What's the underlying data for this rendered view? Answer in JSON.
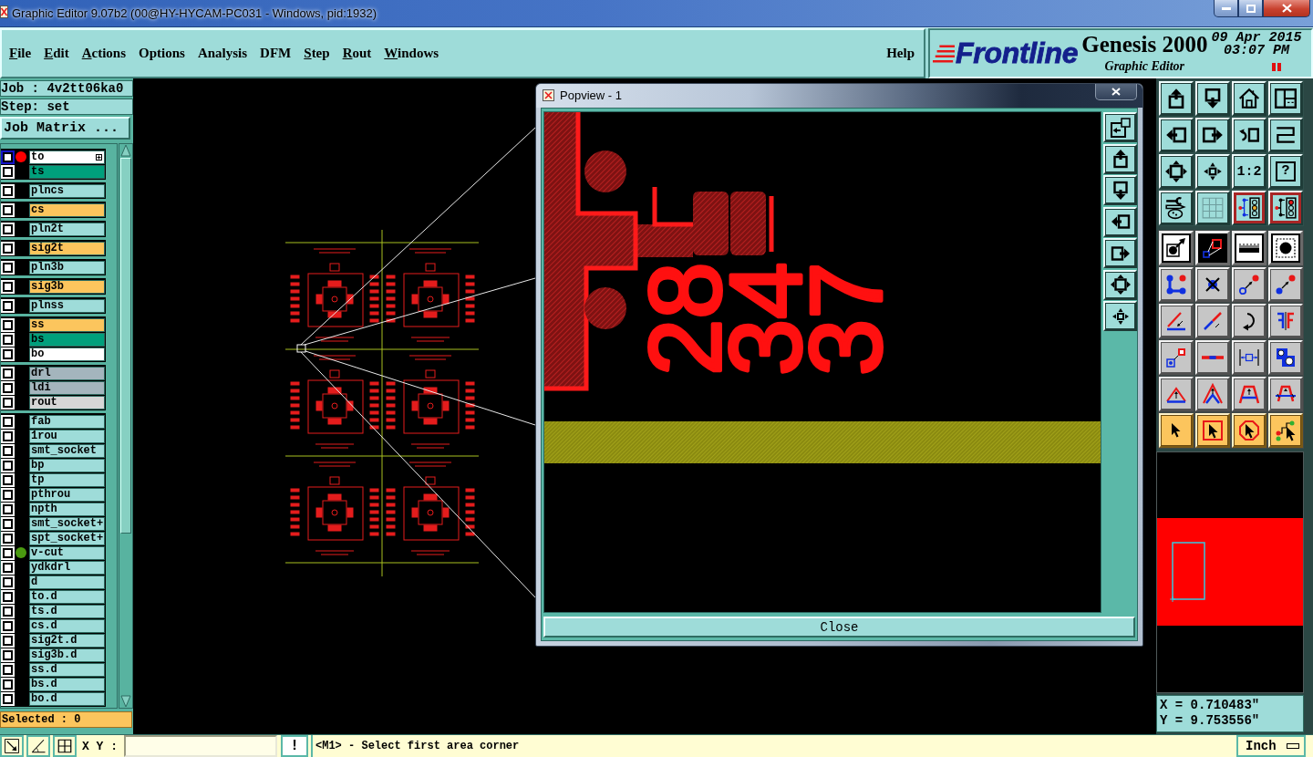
{
  "window": {
    "title": "Graphic Editor 9.07b2 (00@HY-HYCAM-PC031 - Windows, pid:1932)"
  },
  "menu": {
    "items": [
      {
        "label": "File",
        "underlined": true
      },
      {
        "label": "Edit",
        "underlined": true
      },
      {
        "label": "Actions",
        "underlined": true
      },
      {
        "label": "Options",
        "underlined": false
      },
      {
        "label": "Analysis",
        "underlined": false
      },
      {
        "label": "DFM",
        "underlined": false
      },
      {
        "label": "Step",
        "underlined": true
      },
      {
        "label": "Rout",
        "underlined": true
      },
      {
        "label": "Windows",
        "underlined": true
      }
    ],
    "help": {
      "label": "Help",
      "underlined": false
    }
  },
  "brand": {
    "logo": "Frontline",
    "product": "Genesis 2000",
    "subtitle": "Graphic Editor",
    "date": "09 Apr 2015",
    "time": "03:07 PM"
  },
  "job_panel": {
    "job": "Job : 4v2tt06ka0",
    "step": "Step: set",
    "matrix_button": "Job Matrix ...",
    "selected_count": "Selected : 0"
  },
  "layer_list": {
    "groups": [
      [
        {
          "name": "to",
          "color": "#ffffff",
          "checked": false,
          "selected": true,
          "dot": {
            "color": "#ff0000"
          }
        },
        {
          "name": "ts",
          "color": "#00a07c",
          "checked": false,
          "selected": false
        }
      ],
      [
        {
          "name": "plncs",
          "color": "#9edcd9",
          "checked": false,
          "selected": false
        }
      ],
      [
        {
          "name": "cs",
          "color": "#fcc55d",
          "checked": false,
          "selected": false
        }
      ],
      [
        {
          "name": "pln2t",
          "color": "#9edcd9",
          "checked": false,
          "selected": false
        }
      ],
      [
        {
          "name": "sig2t",
          "color": "#fcc55d",
          "checked": false,
          "selected": false
        }
      ],
      [
        {
          "name": "pln3b",
          "color": "#9edcd9",
          "checked": false,
          "selected": false
        }
      ],
      [
        {
          "name": "sig3b",
          "color": "#fcc55d",
          "checked": false,
          "selected": false
        }
      ],
      [
        {
          "name": "plnss",
          "color": "#9edcd9",
          "checked": false,
          "selected": false
        }
      ],
      [
        {
          "name": "ss",
          "color": "#fcc55d",
          "checked": false,
          "selected": false
        },
        {
          "name": "bs",
          "color": "#00a07c",
          "checked": false,
          "selected": false
        },
        {
          "name": "bo",
          "color": "#ffffff",
          "checked": false,
          "selected": false
        }
      ],
      [
        {
          "name": "drl",
          "color": "#a4b5bd",
          "checked": false,
          "selected": false
        },
        {
          "name": "ldi",
          "color": "#a4b5bd",
          "checked": false,
          "selected": false
        },
        {
          "name": "rout",
          "color": "#d6d6d6",
          "checked": false,
          "selected": false
        }
      ],
      [
        {
          "name": "fab",
          "color": "#9edcd9",
          "checked": false,
          "selected": false
        },
        {
          "name": "1rou",
          "color": "#9edcd9",
          "checked": false,
          "selected": false
        },
        {
          "name": "smt_socket",
          "color": "#9edcd9",
          "checked": false,
          "selected": false
        },
        {
          "name": "bp",
          "color": "#9edcd9",
          "checked": false,
          "selected": false
        },
        {
          "name": "tp",
          "color": "#9edcd9",
          "checked": false,
          "selected": false
        },
        {
          "name": "pthrou",
          "color": "#9edcd9",
          "checked": false,
          "selected": false
        },
        {
          "name": "npth",
          "color": "#9edcd9",
          "checked": false,
          "selected": false
        },
        {
          "name": "smt_socket+",
          "color": "#9edcd9",
          "checked": false,
          "selected": false
        },
        {
          "name": "spt_socket+",
          "color": "#9edcd9",
          "checked": false,
          "selected": false
        },
        {
          "name": "v-cut",
          "color": "#9edcd9",
          "checked": false,
          "selected": false,
          "dot": {
            "color": "#4a9a10"
          }
        },
        {
          "name": "ydkdrl",
          "color": "#9edcd9",
          "checked": false,
          "selected": false
        },
        {
          "name": "d",
          "color": "#9edcd9",
          "checked": false,
          "selected": false
        },
        {
          "name": "to.d",
          "color": "#9edcd9",
          "checked": false,
          "selected": false
        },
        {
          "name": "ts.d",
          "color": "#9edcd9",
          "checked": false,
          "selected": false
        },
        {
          "name": "cs.d",
          "color": "#9edcd9",
          "checked": false,
          "selected": false
        },
        {
          "name": "sig2t.d",
          "color": "#9edcd9",
          "checked": false,
          "selected": false
        },
        {
          "name": "sig3b.d",
          "color": "#9edcd9",
          "checked": false,
          "selected": false
        },
        {
          "name": "ss.d",
          "color": "#9edcd9",
          "checked": false,
          "selected": false
        },
        {
          "name": "bs.d",
          "color": "#9edcd9",
          "checked": false,
          "selected": false
        },
        {
          "name": "bo.d",
          "color": "#9edcd9",
          "checked": false,
          "selected": false
        }
      ]
    ]
  },
  "popview": {
    "title": "Popview - 1",
    "silkscreen_labels": [
      "28",
      "34",
      "37"
    ],
    "close_button": "Close"
  },
  "toolbar": {
    "view_buttons": [
      {
        "on": false
      },
      {
        "on": false
      },
      {
        "on": false
      },
      {
        "on": false
      },
      {
        "on": false
      },
      {
        "on": false
      },
      {
        "on": false
      },
      {
        "on": false
      },
      {
        "on": false
      },
      {
        "on": false
      },
      {
        "on": false,
        "label": "1:2"
      },
      {
        "on": false,
        "label": "?"
      },
      {
        "on": false
      },
      {
        "on": false
      },
      {
        "on": true
      },
      {
        "on": true
      }
    ]
  },
  "coordinates": {
    "x": "X = 0.710483\"",
    "y": "Y = 9.753556\""
  },
  "status_bar": {
    "xy_label": "X Y :",
    "alert_button": "!",
    "message": "<M1> - Select first area corner",
    "units_button": "Inch"
  }
}
